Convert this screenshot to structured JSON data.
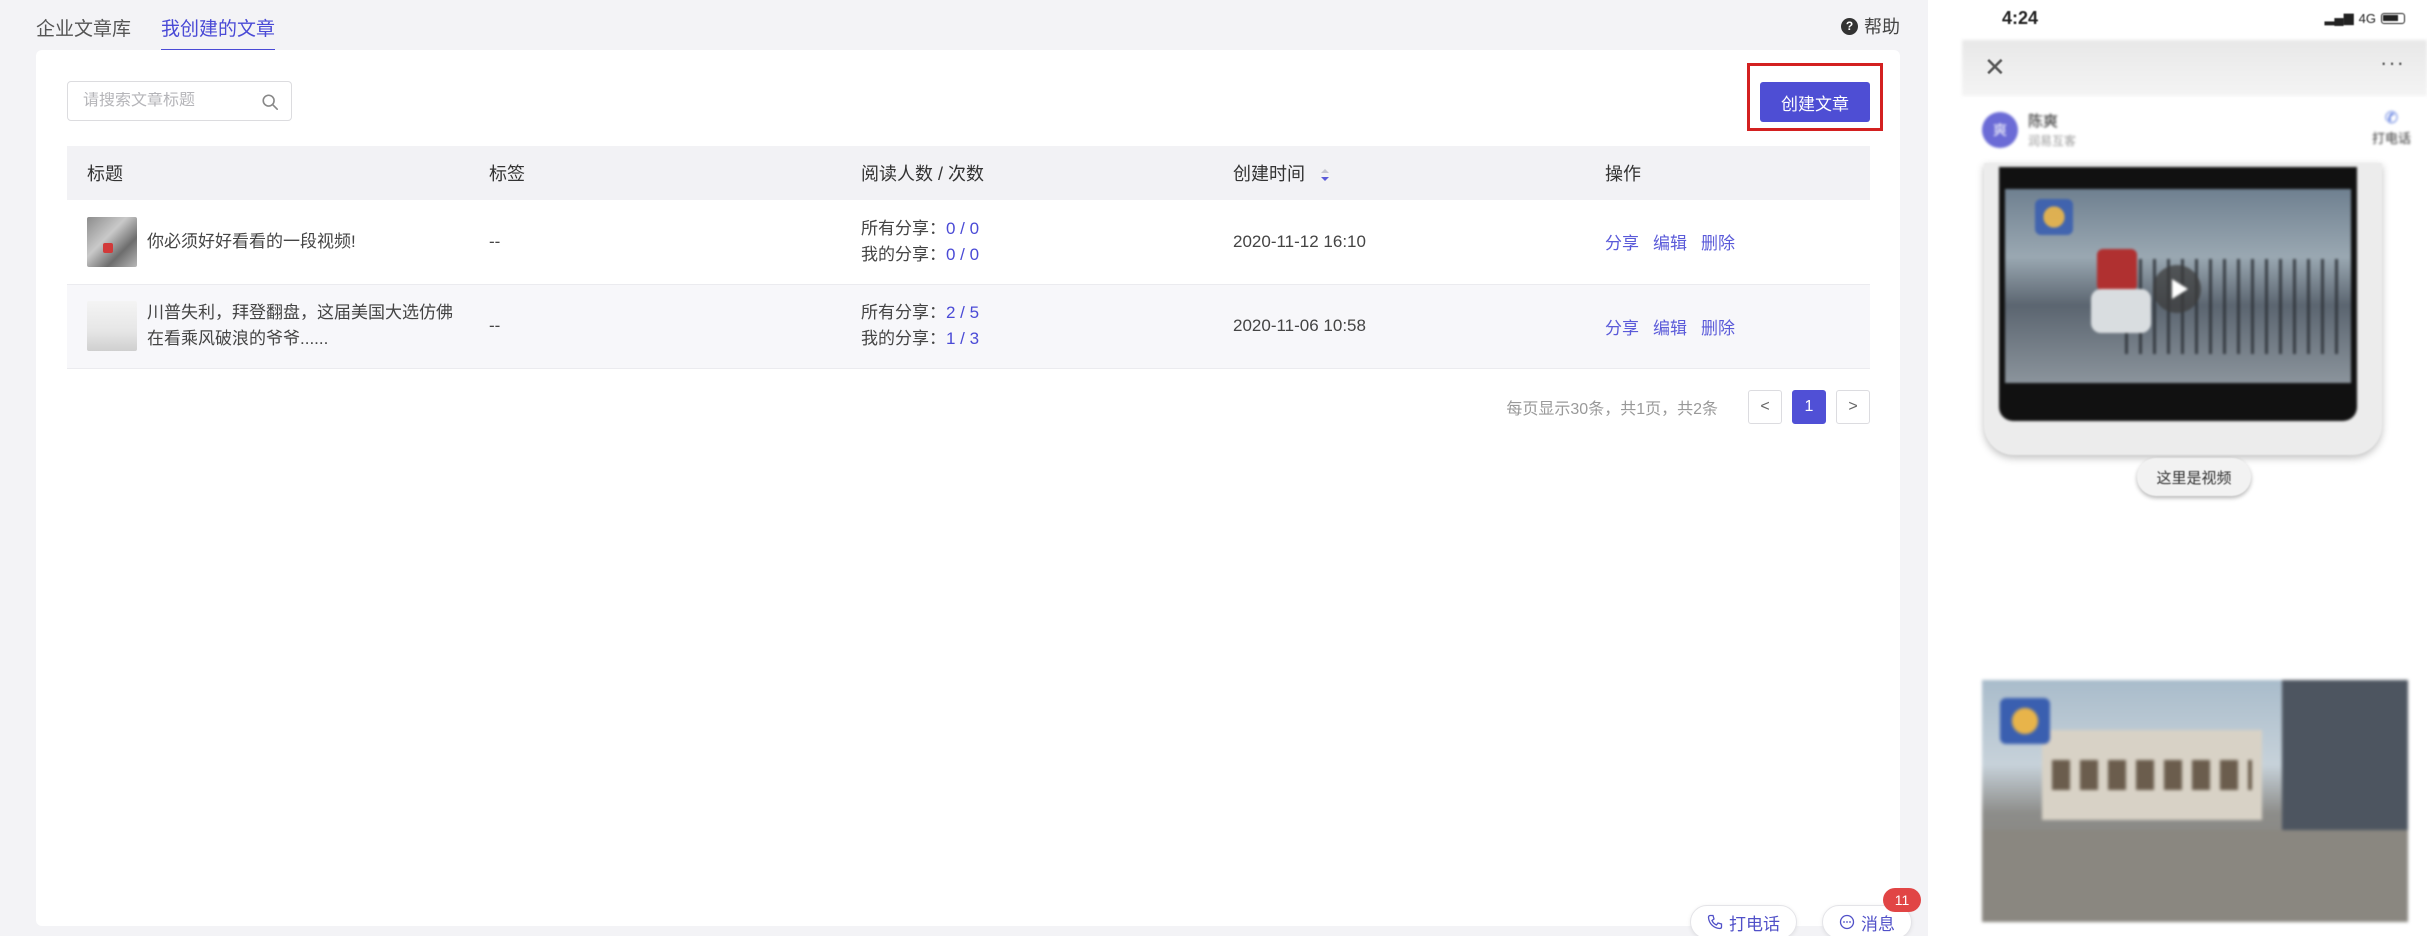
{
  "tabs": [
    {
      "label": "企业文章库",
      "active": false
    },
    {
      "label": "我创建的文章",
      "active": true
    }
  ],
  "help_label": "帮助",
  "search": {
    "placeholder": "请搜索文章标题",
    "value": ""
  },
  "create_button": "创建文章",
  "table": {
    "headers": [
      "标题",
      "标签",
      "阅读人数 / 次数",
      "创建时间",
      "操作"
    ],
    "rows": [
      {
        "title": "你必须好好看看的一段视频!",
        "tag": "--",
        "reads_all_label": "所有分享：",
        "reads_all_value": "0 / 0",
        "reads_mine_label": "我的分享：",
        "reads_mine_value": "0 / 0",
        "created": "2020-11-12 16:10",
        "ops": [
          "分享",
          "编辑",
          "删除"
        ]
      },
      {
        "title": "川普失利，拜登翻盘，这届美国大选仿佛在看乘风破浪的爷爷......",
        "tag": "--",
        "reads_all_label": "所有分享：",
        "reads_all_value": "2 / 5",
        "reads_mine_label": "我的分享：",
        "reads_mine_value": "1 / 3",
        "created": "2020-11-06 10:58",
        "ops": [
          "分享",
          "编辑",
          "删除"
        ]
      }
    ]
  },
  "pagination": {
    "summary": "每页显示30条，共1页，共2条",
    "prev": "<",
    "current": "1",
    "next": ">"
  },
  "float_buttons": {
    "call": "打电话",
    "message": "消息",
    "message_badge": "11"
  },
  "phone": {
    "time": "4:24",
    "network": "4G",
    "close": "✕",
    "more": "···",
    "author_name": "陈爽",
    "author_sub": "润易互客",
    "avatar_text": "爽",
    "call_label": "打电话",
    "video_caption": "这里是视频"
  },
  "colors": {
    "accent": "#4e4ed4",
    "highlight_border": "#d32020",
    "badge": "#e14545"
  }
}
